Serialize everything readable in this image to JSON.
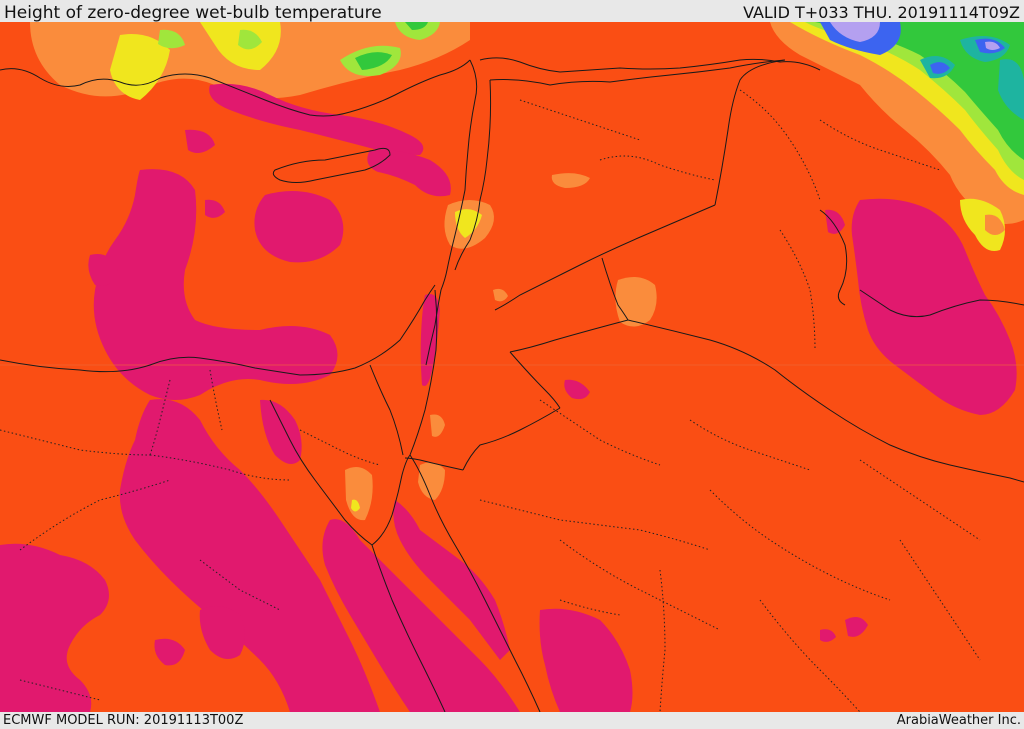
{
  "header": {
    "title": "Height of zero-degree wet-bulb temperature",
    "valid": "VALID T+033 THU. 20191114T09Z"
  },
  "footer": {
    "model_run": "ECMWF MODEL RUN: 20191113T00Z",
    "credit": "ArabiaWeather Inc."
  },
  "palette": {
    "base": "#fa4e14",
    "magenta": "#e1196e",
    "light_orange": "#fa8c3c",
    "yellow": "#f0e61e",
    "light_green": "#a0e63c",
    "green": "#32c83c",
    "teal": "#1eb4a0",
    "blue": "#3c64f0",
    "lavender": "#b4a0f0"
  }
}
